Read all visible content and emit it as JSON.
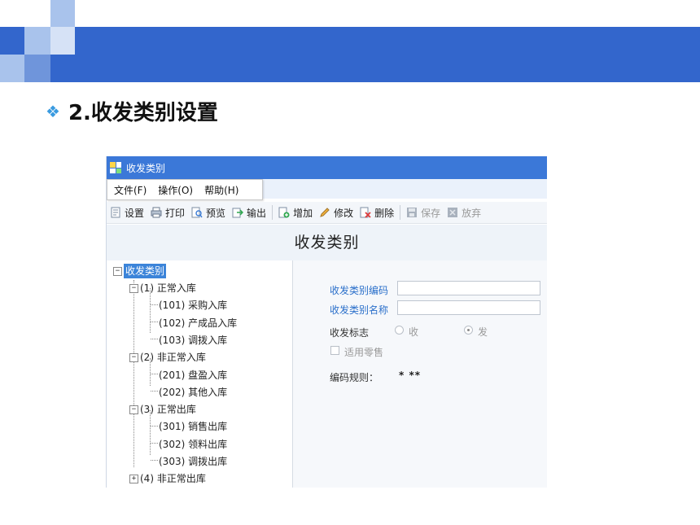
{
  "slide": {
    "bullet": "❖",
    "title": "2.收发类别设置"
  },
  "window": {
    "title": "收发类别",
    "menu": [
      "文件(F)",
      "操作(O)",
      "帮助(H)"
    ],
    "toolbar": [
      {
        "label": "设置",
        "icon": "settings-icon",
        "disabled": false
      },
      {
        "label": "打印",
        "icon": "print-icon",
        "disabled": false
      },
      {
        "label": "预览",
        "icon": "preview-icon",
        "disabled": false
      },
      {
        "label": "输出",
        "icon": "export-icon",
        "disabled": false
      },
      {
        "label": "增加",
        "icon": "add-icon",
        "disabled": false
      },
      {
        "label": "修改",
        "icon": "edit-pencil-icon",
        "disabled": false
      },
      {
        "label": "删除",
        "icon": "delete-icon",
        "disabled": false
      },
      {
        "label": "保存",
        "icon": "save-icon",
        "disabled": true
      },
      {
        "label": "放弃",
        "icon": "discard-icon",
        "disabled": true
      }
    ],
    "form_title": "收发类别"
  },
  "tree": {
    "root": "收发类别",
    "groups": [
      {
        "label": "(1) 正常入库",
        "expanded": true,
        "children": [
          "(101) 采购入库",
          "(102) 产成品入库",
          "(103) 调拨入库"
        ]
      },
      {
        "label": "(2) 非正常入库",
        "expanded": true,
        "children": [
          "(201) 盘盈入库",
          "(202) 其他入库"
        ]
      },
      {
        "label": "(3) 正常出库",
        "expanded": true,
        "children": [
          "(301) 销售出库",
          "(302) 领料出库",
          "(303) 调拨出库"
        ]
      },
      {
        "label": "(4) 非正常出库",
        "expanded": false,
        "children": []
      }
    ]
  },
  "detail": {
    "code_label": "收发类别编码",
    "code_value": "",
    "name_label": "收发类别名称",
    "name_value": "",
    "flag_label": "收发标志",
    "radio_receive": "收",
    "radio_send": "发",
    "selected_flag": "发",
    "retail_label": "适用零售",
    "retail_checked": false,
    "rule_label": "编码规则：",
    "rule_value": "* **"
  },
  "colors": {
    "header_blue": "#3366cc",
    "titlebar_blue": "#3b78d8",
    "label_blue": "#2a6fca",
    "selection_blue": "#3c84d9"
  }
}
